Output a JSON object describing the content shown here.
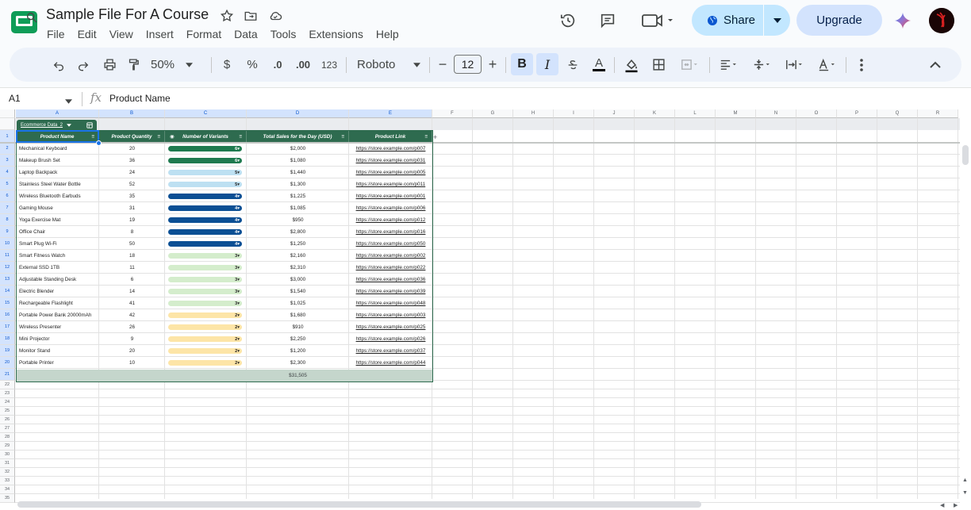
{
  "doc": {
    "title": "Sample File For A Course"
  },
  "menu": [
    "File",
    "Edit",
    "View",
    "Insert",
    "Format",
    "Data",
    "Tools",
    "Extensions",
    "Help"
  ],
  "header": {
    "share_label": "Share",
    "upgrade_label": "Upgrade"
  },
  "toolbar": {
    "zoom": "50%",
    "currency": "$",
    "percent": "%",
    "decrease_decimal": ".0",
    "increase_decimal": ".00",
    "number_format": "123",
    "font": "Roboto",
    "font_size": "12",
    "minus": "−",
    "plus": "+",
    "bold": "B",
    "italic": "I",
    "text_color": "A"
  },
  "formula_bar": {
    "cell_ref": "A1",
    "fx": "fx",
    "value": "Product Name"
  },
  "columns": [
    "A",
    "B",
    "C",
    "D",
    "E",
    "F",
    "G",
    "H",
    "I",
    "J",
    "K",
    "L",
    "M",
    "N",
    "O",
    "P",
    "Q",
    "R"
  ],
  "rows": [
    "1",
    "2",
    "3",
    "4",
    "5",
    "6",
    "7",
    "8",
    "9",
    "10",
    "11",
    "12",
    "13",
    "14",
    "15",
    "16",
    "17",
    "18",
    "19",
    "20",
    "21",
    "22",
    "23",
    "24",
    "25",
    "26",
    "27",
    "28",
    "29",
    "30",
    "31",
    "32",
    "33",
    "34",
    "35"
  ],
  "table": {
    "name": "Ecommerce Data_2",
    "headers": [
      "Product Name",
      "Product Quantity",
      "Number of Variants",
      "Total Sales for the Day (USD)",
      "Product Link"
    ],
    "rows": [
      {
        "name": "Mechanical Keyboard",
        "qty": "20",
        "variants": "6",
        "sales": "$2,000",
        "link": "https://store.example.com/p007"
      },
      {
        "name": "Makeup Brush Set",
        "qty": "36",
        "variants": "6",
        "sales": "$1,080",
        "link": "https://store.example.com/p031"
      },
      {
        "name": "Laptop Backpack",
        "qty": "24",
        "variants": "5",
        "sales": "$1,440",
        "link": "https://store.example.com/p005"
      },
      {
        "name": "Stainless Steel Water Bottle",
        "qty": "52",
        "variants": "5",
        "sales": "$1,300",
        "link": "https://store.example.com/p011"
      },
      {
        "name": "Wireless Bluetooth Earbuds",
        "qty": "35",
        "variants": "4",
        "sales": "$1,225",
        "link": "https://store.example.com/p001"
      },
      {
        "name": "Gaming Mouse",
        "qty": "31",
        "variants": "4",
        "sales": "$1,085",
        "link": "https://store.example.com/p006"
      },
      {
        "name": "Yoga Exercise Mat",
        "qty": "19",
        "variants": "4",
        "sales": "$950",
        "link": "https://store.example.com/p012"
      },
      {
        "name": "Office Chair",
        "qty": "8",
        "variants": "4",
        "sales": "$2,800",
        "link": "https://store.example.com/p016"
      },
      {
        "name": "Smart Plug Wi-Fi",
        "qty": "50",
        "variants": "4",
        "sales": "$1,250",
        "link": "https://store.example.com/p050"
      },
      {
        "name": "Smart Fitness Watch",
        "qty": "18",
        "variants": "3",
        "sales": "$2,160",
        "link": "https://store.example.com/p002"
      },
      {
        "name": "External SSD 1TB",
        "qty": "11",
        "variants": "3",
        "sales": "$2,310",
        "link": "https://store.example.com/p022"
      },
      {
        "name": "Adjustable Standing Desk",
        "qty": "6",
        "variants": "3",
        "sales": "$3,000",
        "link": "https://store.example.com/p036"
      },
      {
        "name": "Electric Blender",
        "qty": "14",
        "variants": "3",
        "sales": "$1,540",
        "link": "https://store.example.com/p039"
      },
      {
        "name": "Rechargeable Flashlight",
        "qty": "41",
        "variants": "3",
        "sales": "$1,025",
        "link": "https://store.example.com/p048"
      },
      {
        "name": "Portable Power Bank 20000mAh",
        "qty": "42",
        "variants": "2",
        "sales": "$1,680",
        "link": "https://store.example.com/p003"
      },
      {
        "name": "Wireless Presenter",
        "qty": "26",
        "variants": "2",
        "sales": "$910",
        "link": "https://store.example.com/p025"
      },
      {
        "name": "Mini Projector",
        "qty": "9",
        "variants": "2",
        "sales": "$2,250",
        "link": "https://store.example.com/p026"
      },
      {
        "name": "Monitor Stand",
        "qty": "20",
        "variants": "2",
        "sales": "$1,200",
        "link": "https://store.example.com/p037"
      },
      {
        "name": "Portable Printer",
        "qty": "10",
        "variants": "2",
        "sales": "$2,300",
        "link": "https://store.example.com/p044"
      }
    ],
    "total_sales": "$31,505"
  },
  "colors": {
    "table_header": "#2e6b4f",
    "chip_6": "#1e7a4f",
    "chip_5": "#bde0f2",
    "chip_4": "#0b4f94",
    "chip_3": "#d4edcc",
    "chip_2": "#fde5a7",
    "share_bg": "#c2e7ff",
    "upgrade_bg": "#d3e3fd",
    "selection": "#1a73e8"
  }
}
